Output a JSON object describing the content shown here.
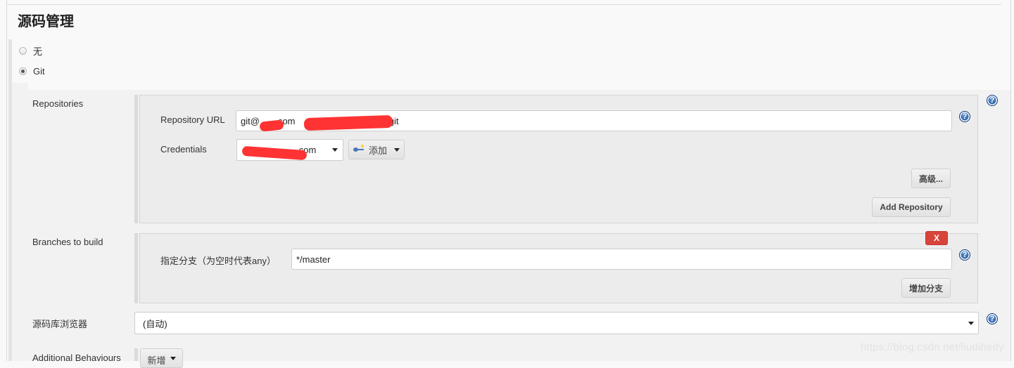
{
  "section": {
    "title": "源码管理"
  },
  "scm_options": [
    {
      "label": "无",
      "selected": false
    },
    {
      "label": "Git",
      "selected": true
    }
  ],
  "repositories": {
    "label": "Repositories",
    "url_label": "Repository URL",
    "url_value_prefix": "git@",
    "url_value_mid": "com",
    "url_value_suffix": "t.git",
    "credentials_label": "Credentials",
    "credentials_value_prefix": "li",
    "credentials_value_suffix": "com",
    "add_button_label": "添加",
    "advanced_button_label": "高级...",
    "add_repository_button_label": "Add Repository"
  },
  "branches": {
    "label": "Branches to build",
    "branch_field_label": "指定分支（为空时代表any）",
    "branch_value": "*/master",
    "delete_button_label": "X",
    "add_branch_button_label": "增加分支"
  },
  "repo_browser": {
    "label": "源码库浏览器",
    "selected": "(自动)"
  },
  "additional_behaviours": {
    "label": "Additional Behaviours",
    "add_button_label": "新增"
  },
  "help_icon_glyph": "?",
  "watermark": "https://blog.csdn.net/liudihedy",
  "colors": {
    "delete_button": "#d9443a",
    "help_icon": "#1f4f96",
    "redaction": "#ff3333"
  }
}
